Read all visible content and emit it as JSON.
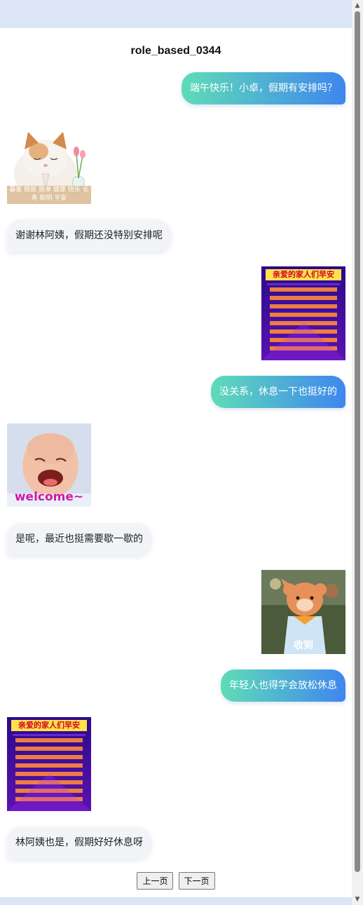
{
  "title": "role_based_0344",
  "messages": [
    {
      "side": "right",
      "type": "text",
      "text": "端午快乐！小卓，假期有安排吗？"
    },
    {
      "side": "left",
      "type": "sticker",
      "sticker": "cat-praying",
      "caption": "暴富 精致 脱单 健康 快乐 长寿 聪明 平安"
    },
    {
      "side": "left",
      "type": "text",
      "text": "谢谢林阿姨，假期还没特别安排呢"
    },
    {
      "side": "right",
      "type": "sticker",
      "sticker": "good-morning-card",
      "caption": "亲爱的家人们早安"
    },
    {
      "side": "right",
      "type": "text",
      "text": "没关系，休息一下也挺好的"
    },
    {
      "side": "left",
      "type": "sticker",
      "sticker": "laughing-baby",
      "caption": "welcome~"
    },
    {
      "side": "left",
      "type": "text",
      "text": "是呢，最近也挺需要歇一歇的"
    },
    {
      "side": "right",
      "type": "sticker",
      "sticker": "bear-salute",
      "caption": "收到"
    },
    {
      "side": "right",
      "type": "text",
      "text": "年轻人也得学会放松休息"
    },
    {
      "side": "left",
      "type": "sticker",
      "sticker": "good-morning-card",
      "caption": "亲爱的家人们早安"
    },
    {
      "side": "left",
      "type": "text",
      "text": "林阿姨也是，假期好好休息呀"
    }
  ],
  "pager": {
    "prev_label": "上一页",
    "next_label": "下一页"
  },
  "colors": {
    "bubble_right_start": "#5fdcb7",
    "bubble_right_end": "#3f86ee",
    "bubble_left": "#f2f4f8",
    "page_background": "#dbe5f5"
  }
}
